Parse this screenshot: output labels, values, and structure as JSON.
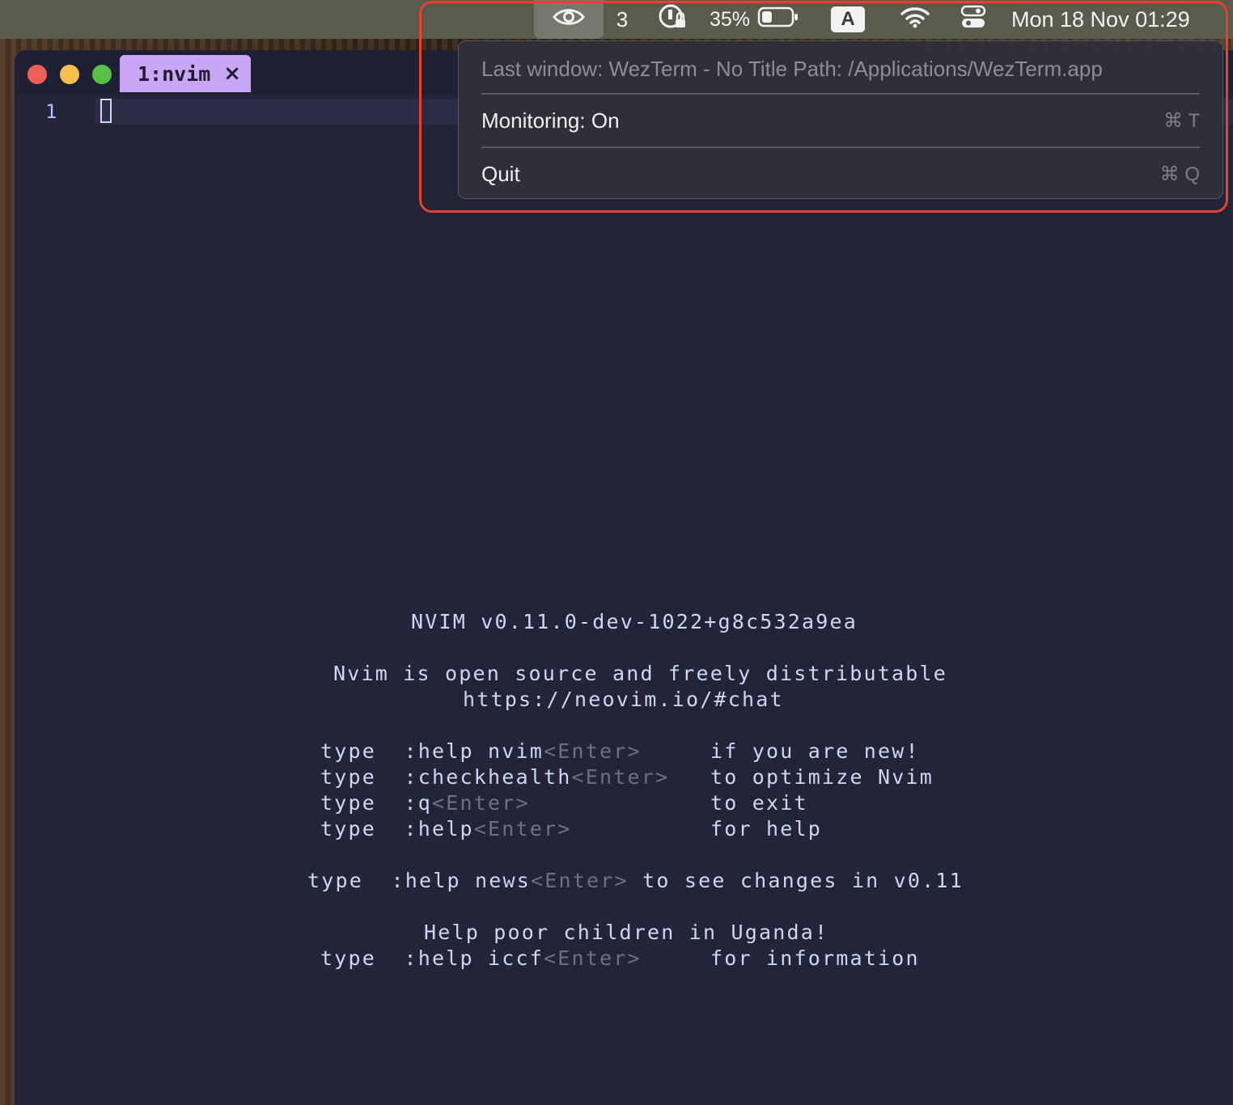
{
  "menubar": {
    "count": "3",
    "battery_percent": "35%",
    "battery_level": 0.35,
    "input_source": "A",
    "datetime": "Mon 18 Nov  01:29",
    "icons": [
      "eye-icon",
      "key-lock-icon",
      "battery-icon",
      "wifi-icon",
      "control-center-icon"
    ]
  },
  "menu": {
    "last_window": "Last window: WezTerm - No Title Path: /Applications/WezTerm.app",
    "monitoring_label": "Monitoring: On",
    "monitoring_shortcut": "⌘ T",
    "quit_label": "Quit",
    "quit_shortcut": "⌘ Q"
  },
  "terminal": {
    "tab_title": "1:nvim",
    "tab_close": "×",
    "line_number": "1"
  },
  "intro": {
    "version": "NVIM v0.11.0-dev-1022+g8c532a9ea",
    "line1": "Nvim is open source and freely distributable",
    "line2": "https://neovim.io/#chat",
    "rows": [
      {
        "type": "type",
        "cmd": ":help nvim",
        "enter": "<Enter>",
        "desc": "if you are new!"
      },
      {
        "type": "type",
        "cmd": ":checkhealth",
        "enter": "<Enter>",
        "desc": "to optimize Nvim"
      },
      {
        "type": "type",
        "cmd": ":q",
        "enter": "<Enter>",
        "desc": "to exit"
      },
      {
        "type": "type",
        "cmd": ":help",
        "enter": "<Enter>",
        "desc": "for help"
      }
    ],
    "news": {
      "type": "type",
      "cmd": ":help news",
      "enter": "<Enter>",
      "desc": "to see changes in v0.11"
    },
    "uganda": "Help poor children in Uganda!",
    "iccf": {
      "type": "type",
      "cmd": ":help iccf",
      "enter": "<Enter>",
      "desc": "for information"
    }
  },
  "colors": {
    "accent_tab": "#caa6f7",
    "terminal_bg": "#232438",
    "highlight": "#e8412e"
  }
}
